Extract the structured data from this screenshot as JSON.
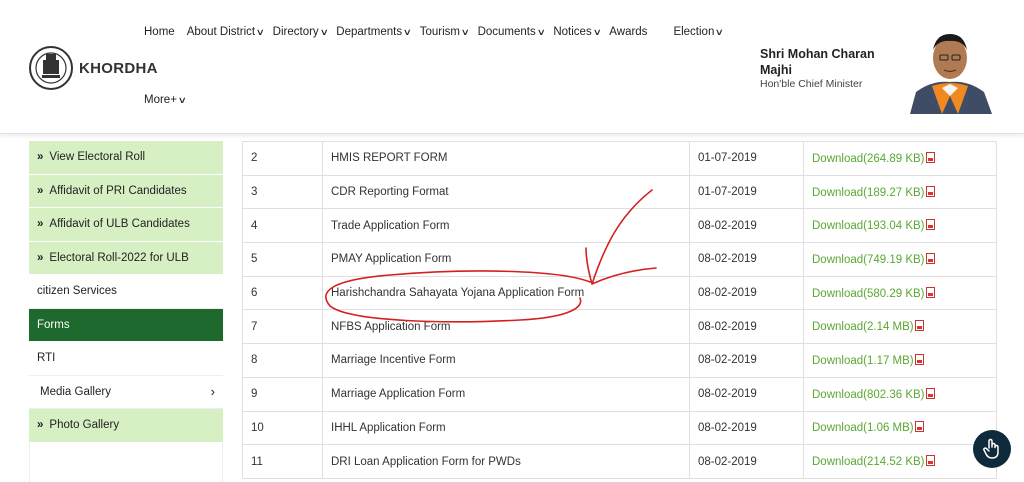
{
  "header": {
    "site_name": "KHORDHA",
    "nav": [
      {
        "label": "Home",
        "has_dropdown": false
      },
      {
        "label": "About District",
        "has_dropdown": true
      },
      {
        "label": "Directory",
        "has_dropdown": true
      },
      {
        "label": "Departments",
        "has_dropdown": true
      },
      {
        "label": "Tourism",
        "has_dropdown": true
      },
      {
        "label": "Documents",
        "has_dropdown": true
      },
      {
        "label": "Notices",
        "has_dropdown": true
      },
      {
        "label": "Awards",
        "has_dropdown": false
      },
      {
        "label": "Election",
        "has_dropdown": true
      }
    ],
    "more_label": "More+",
    "cm_name": "Shri Mohan Charan Majhi",
    "cm_title": "Hon'ble Chief Minister"
  },
  "sidebar": {
    "items": [
      {
        "label": "View Electoral Roll",
        "style": "green"
      },
      {
        "label": "Affidavit of PRI Candidates",
        "style": "green"
      },
      {
        "label": "Affidavit of ULB Candidates",
        "style": "green"
      },
      {
        "label": "Electoral Roll-2022 for ULB",
        "style": "green"
      },
      {
        "label": "citizen Services",
        "style": "plain"
      },
      {
        "label": "Forms",
        "style": "active"
      },
      {
        "label": "RTI",
        "style": "plain"
      },
      {
        "label": "Media Gallery",
        "style": "media"
      },
      {
        "label": "Photo Gallery",
        "style": "green"
      }
    ]
  },
  "table": {
    "rows": [
      {
        "no": "2",
        "title": "HMIS REPORT FORM",
        "date": "01-07-2019",
        "download": "Download(264.89 KB)"
      },
      {
        "no": "3",
        "title": "CDR Reporting Format",
        "date": "01-07-2019",
        "download": "Download(189.27 KB)"
      },
      {
        "no": "4",
        "title": "Trade Application Form",
        "date": "08-02-2019",
        "download": "Download(193.04 KB)"
      },
      {
        "no": "5",
        "title": "PMAY Application Form",
        "date": "08-02-2019",
        "download": "Download(749.19 KB)"
      },
      {
        "no": "6",
        "title": "Harishchandra Sahayata Yojana Application Form",
        "date": "08-02-2019",
        "download": "Download(580.29 KB)"
      },
      {
        "no": "7",
        "title": "NFBS Application Form",
        "date": "08-02-2019",
        "download": "Download(2.14 MB)"
      },
      {
        "no": "8",
        "title": "Marriage Incentive Form",
        "date": "08-02-2019",
        "download": "Download(1.17 MB)"
      },
      {
        "no": "9",
        "title": "Marriage Application Form",
        "date": "08-02-2019",
        "download": "Download(802.36 KB)"
      },
      {
        "no": "10",
        "title": "IHHL Application Form",
        "date": "08-02-2019",
        "download": "Download(1.06 MB)"
      },
      {
        "no": "11",
        "title": "DRI Loan Application Form for PWDs",
        "date": "08-02-2019",
        "download": "Download(214.52 KB)"
      }
    ]
  },
  "colors": {
    "sidebar_green": "#d6f0c4",
    "sidebar_active": "#1e6a2e",
    "download_link": "#5aa832",
    "annotation_red": "#d42020",
    "fab_bg": "#0f2a3a"
  },
  "icons": {
    "dropdown": "chevron-down-icon",
    "pdf": "pdf-icon",
    "fab": "hand-pointer-icon"
  }
}
